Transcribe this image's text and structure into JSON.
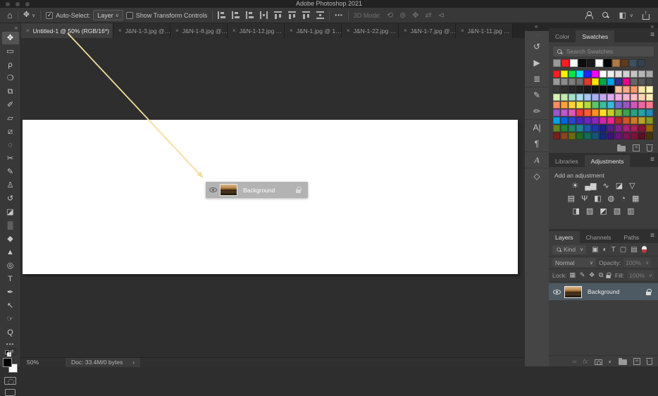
{
  "window": {
    "title": "Adobe Photoshop 2021"
  },
  "options_bar": {
    "home_glyph": "⌂",
    "move_glyph": "✥",
    "chevron": "∨",
    "auto_select": {
      "label": "Auto-Select:",
      "checked": true,
      "check_glyph": "✓"
    },
    "target": {
      "value": "Layer"
    },
    "transform": {
      "label": "Show Transform Controls",
      "checked": false
    },
    "align_icons": [
      "align-left",
      "align-center-horizontal",
      "align-right",
      "distribute-horizontal",
      "align-top",
      "align-middle",
      "align-bottom",
      "distribute-vertical"
    ],
    "more_glyph": "•••",
    "mode_label": "3D Mode:",
    "mode_icons": [
      {
        "name": "3d-orbit-icon",
        "glyph": "⟲"
      },
      {
        "name": "3d-roll-icon",
        "glyph": "⊚"
      },
      {
        "name": "3d-drag-icon",
        "glyph": "✥"
      },
      {
        "name": "3d-slide-icon",
        "glyph": "⇄"
      },
      {
        "name": "3d-camera-icon",
        "glyph": "⊲"
      }
    ]
  },
  "tabs": [
    {
      "label": "Untitled-1 @ 50% (RGB/16*)",
      "close": "×",
      "active": true
    },
    {
      "label": "J&N-1-3.jpg @…",
      "close": "×",
      "active": false
    },
    {
      "label": "J&N-1-8.jpg @…",
      "close": "×",
      "active": false
    },
    {
      "label": "J&N-1-12.jpg …",
      "close": "×",
      "active": false
    },
    {
      "label": "J&N-1.jpg @ 1…",
      "close": "×",
      "active": false
    },
    {
      "label": "J&N-1-22.jpg …",
      "close": "×",
      "active": false
    },
    {
      "label": "J&N-1-7.jpg @…",
      "close": "×",
      "active": false
    },
    {
      "label": "J&N-1-11.jpg …",
      "close": "×",
      "active": false
    }
  ],
  "toolbar": {
    "expand_chevron": "»",
    "more_glyph": "•••",
    "swap_glyph": "⇄",
    "tools": [
      {
        "name": "move-tool",
        "glyph": "✥",
        "selected": true
      },
      {
        "name": "marquee-tool",
        "glyph": "▭",
        "selected": false
      },
      {
        "name": "lasso-tool",
        "glyph": "ρ",
        "selected": false
      },
      {
        "name": "quick-selection-tool",
        "glyph": "❍",
        "selected": false
      },
      {
        "name": "crop-tool",
        "glyph": "⧉",
        "selected": false
      },
      {
        "name": "eyedropper-tool",
        "glyph": "✐",
        "selected": false
      },
      {
        "name": "patch-tool",
        "glyph": "▱",
        "selected": false
      },
      {
        "name": "healing-brush-tool",
        "glyph": "⧄",
        "selected": false
      },
      {
        "name": "spot-healing-tool",
        "glyph": "◌",
        "selected": false
      },
      {
        "name": "slice-tool",
        "glyph": "✂",
        "selected": false
      },
      {
        "name": "brush-tool",
        "glyph": "✎",
        "selected": false
      },
      {
        "name": "clone-stamp-tool",
        "glyph": "♙",
        "selected": false
      },
      {
        "name": "history-brush-tool",
        "glyph": "↺",
        "selected": false
      },
      {
        "name": "eraser-tool",
        "glyph": "◪",
        "selected": false
      },
      {
        "name": "gradient-tool",
        "glyph": "▒",
        "selected": false
      },
      {
        "name": "blur-tool",
        "glyph": "◆",
        "selected": false
      },
      {
        "name": "sharpen-tool",
        "glyph": "▲",
        "selected": false
      },
      {
        "name": "dodge-tool",
        "glyph": "◎",
        "selected": false
      },
      {
        "name": "type-tool",
        "glyph": "T",
        "selected": false
      },
      {
        "name": "pen-tool",
        "glyph": "✒",
        "selected": false
      },
      {
        "name": "path-selection-tool",
        "glyph": "↖",
        "selected": false
      },
      {
        "name": "hand-tool",
        "glyph": "☞",
        "selected": false
      },
      {
        "name": "zoom-tool",
        "glyph": "Q",
        "selected": false
      }
    ]
  },
  "canvas": {
    "floating_layer": {
      "name": "Background"
    }
  },
  "arrow": {
    "color": "#f3dd9c"
  },
  "status_bar": {
    "zoom": "50%",
    "doc": "Doc: 33.4M/0 bytes",
    "chevron": "›"
  },
  "dock": {
    "collapse_chevron": "«",
    "expand_chevron": "»",
    "strip_icons": [
      {
        "name": "history-panel-icon",
        "glyph": "↺",
        "sep": false
      },
      {
        "name": "actions-panel-icon",
        "glyph": "▶",
        "sep": false
      },
      {
        "name": "properties-panel-icon",
        "glyph": "≣",
        "sep": false
      },
      {
        "name": "tool-presets-panel-icon",
        "glyph": "✎",
        "sep": true
      },
      {
        "name": "brush-settings-panel-icon",
        "glyph": "✏",
        "sep": false
      },
      {
        "name": "character-panel-icon",
        "glyph": "A|",
        "sep": true
      },
      {
        "name": "paragraph-panel-icon",
        "glyph": "¶",
        "sep": false
      },
      {
        "name": "glyphs-panel-icon",
        "glyph": "A",
        "italic": true,
        "sep": true
      },
      {
        "name": "3d-panel-icon",
        "glyph": "◇",
        "sep": true
      }
    ]
  },
  "swatches_panel": {
    "tabs": [
      {
        "label": "Color",
        "active": false
      },
      {
        "label": "Swatches",
        "active": true
      }
    ],
    "menu_glyph": "≡",
    "search_placeholder": "Search Swatches",
    "recent": [
      "#9a9a9a",
      "#ff1d25",
      "#ffffff",
      "#0d0d0d",
      "#1a1a1a",
      "#ffffff",
      "#000000",
      "#b07a45",
      "#5f3c1e",
      "#40505c",
      "#334250"
    ],
    "grid": [
      [
        "#ff1d25",
        "#fff200",
        "#00e54c",
        "#00e5ff",
        "#2323ff",
        "#ff00ff",
        "#ffffff",
        "#eeeeee",
        "#e0e0e0",
        "#d2d2d2",
        "#c4c4c4",
        "#b6b6b6",
        "#a8a8a8"
      ],
      [
        "#9a9a9a",
        "#8c8c8c",
        "#7e7e7e",
        "#707070",
        "#e8362d",
        "#ffe800",
        "#00a651",
        "#00a2e8",
        "#2e3192",
        "#ec008c",
        "#666666",
        "#585858",
        "#4a4a4a"
      ],
      [
        "#3c3c3c",
        "#303030",
        "#282828",
        "#202020",
        "#181818",
        "#101010",
        "#080808",
        "#000000",
        "#ffc09c",
        "#ffaa87",
        "#f79a6b",
        "#ffe9a8",
        "#fff7bd"
      ],
      [
        "#d9f2b5",
        "#c3eab0",
        "#a5e0cb",
        "#aadcf2",
        "#a9c8f2",
        "#a9b0f2",
        "#c3a9f2",
        "#daadf0",
        "#f0aee4",
        "#f7b5d2",
        "#ffbdc5",
        "#ffd6b5",
        "#ffeeb5"
      ],
      [
        "#ff8a66",
        "#ffa03c",
        "#ffd23c",
        "#e9e93f",
        "#b6d943",
        "#62c26c",
        "#3cbda2",
        "#3cb8dc",
        "#7a66cc",
        "#9a57c4",
        "#cf57bb",
        "#ef66a3",
        "#ff7a90"
      ],
      [
        "#9a57cf",
        "#c357cf",
        "#e357bb",
        "#ef3a3f",
        "#ff5f31",
        "#ff9027",
        "#ffdf27",
        "#c3d227",
        "#7aba3c",
        "#3ca351",
        "#27a384",
        "#27a3a3",
        "#278aba"
      ],
      [
        "#00a2ea",
        "#0066e0",
        "#2747cf",
        "#4727bb",
        "#6927bb",
        "#8a27bb",
        "#cf27aa",
        "#ef278a",
        "#ba2727",
        "#cf5727",
        "#cf7a27",
        "#baa327",
        "#8a9a27"
      ],
      [
        "#66841f",
        "#1f8436",
        "#1f8466",
        "#1f849a",
        "#1f57aa",
        "#1f36aa",
        "#1f1f8a",
        "#571f8a",
        "#8a1f8a",
        "#aa1f7a",
        "#aa1f57",
        "#8a1336",
        "#9a6600"
      ],
      [
        "#7a1f1f",
        "#8a471f",
        "#6b6b13",
        "#1f6b27",
        "#136b5b",
        "#13577a",
        "#132a7a",
        "#3c137a",
        "#6b137a",
        "#7a1357",
        "#7a1336",
        "#5b0f23",
        "#423610"
      ]
    ]
  },
  "adjustments_panel": {
    "tabs": [
      {
        "label": "Libraries",
        "active": false
      },
      {
        "label": "Adjustments",
        "active": true
      }
    ],
    "menu_glyph": "≡",
    "heading": "Add an adjustment",
    "rows": [
      [
        {
          "name": "brightness-contrast-icon",
          "glyph": "☀"
        },
        {
          "name": "levels-icon",
          "glyph": "▄▆"
        },
        {
          "name": "curves-icon",
          "glyph": "∿"
        },
        {
          "name": "exposure-icon",
          "glyph": "◪"
        },
        {
          "name": "vibrance-icon",
          "glyph": "▽"
        }
      ],
      [
        {
          "name": "hue-saturation-icon",
          "glyph": "▤"
        },
        {
          "name": "color-balance-icon",
          "glyph": "Ψ"
        },
        {
          "name": "black-white-icon",
          "glyph": "◧"
        },
        {
          "name": "photo-filter-icon",
          "glyph": "◍"
        },
        {
          "name": "channel-mixer-icon",
          "glyph": "◔"
        },
        {
          "name": "color-lookup-icon",
          "glyph": "▦"
        }
      ],
      [
        {
          "name": "invert-icon",
          "glyph": "◨"
        },
        {
          "name": "posterize-icon",
          "glyph": "▨"
        },
        {
          "name": "threshold-icon",
          "glyph": "◩"
        },
        {
          "name": "gradient-map-icon",
          "glyph": "▧"
        },
        {
          "name": "selective-color-icon",
          "glyph": "▥"
        }
      ]
    ]
  },
  "layers_panel": {
    "tabs": [
      {
        "label": "Layers",
        "active": true
      },
      {
        "label": "Channels",
        "active": false
      },
      {
        "label": "Paths",
        "active": false
      }
    ],
    "menu_glyph": "≡",
    "filter": {
      "label": "Kind",
      "chevron": "∨",
      "icons": [
        {
          "name": "filter-pixel-layers-icon",
          "glyph": "▣"
        },
        {
          "name": "filter-adjustment-layers-icon",
          "glyph": "◐"
        },
        {
          "name": "filter-type-layers-icon",
          "glyph": "T"
        },
        {
          "name": "filter-shape-layers-icon",
          "glyph": "▢"
        },
        {
          "name": "filter-smart-objects-icon",
          "glyph": "▤"
        }
      ]
    },
    "blend": {
      "value": "Normal",
      "chevron": "∨",
      "opacity_label": "Opacity:",
      "opacity_value": "100%"
    },
    "lock": {
      "label": "Lock:",
      "icons": [
        {
          "name": "lock-transparent-pixels-icon",
          "glyph": "▦"
        },
        {
          "name": "lock-image-pixels-icon",
          "glyph": "✎"
        },
        {
          "name": "lock-position-icon",
          "glyph": "✥"
        },
        {
          "name": "lock-artboard-icon",
          "glyph": "⧉"
        }
      ],
      "fill_label": "Fill:",
      "fill_value": "100%"
    },
    "layer": {
      "name": "Background"
    },
    "footer_icons": [
      {
        "name": "link-layers-icon",
        "glyph": "∞",
        "dim": true,
        "plain": true
      },
      {
        "name": "layer-style-icon",
        "glyph": "fx",
        "dim": true,
        "plain": false
      },
      {
        "name": "layer-mask-icon",
        "css": "i-mask"
      },
      {
        "name": "adjustment-layer-icon",
        "glyph": "◐",
        "dim": false,
        "plain": true
      },
      {
        "name": "group-layers-icon",
        "css": "i-folder"
      },
      {
        "name": "new-layer-icon",
        "css": "i-new"
      },
      {
        "name": "delete-layer-icon",
        "css": "i-trash"
      }
    ]
  },
  "colors": {
    "selected_layer_bg": "#4e5a63",
    "arrow": "#f3dd9c",
    "canvas_bg": "#2e2e2e",
    "panel_bg": "#3d3d3d"
  }
}
